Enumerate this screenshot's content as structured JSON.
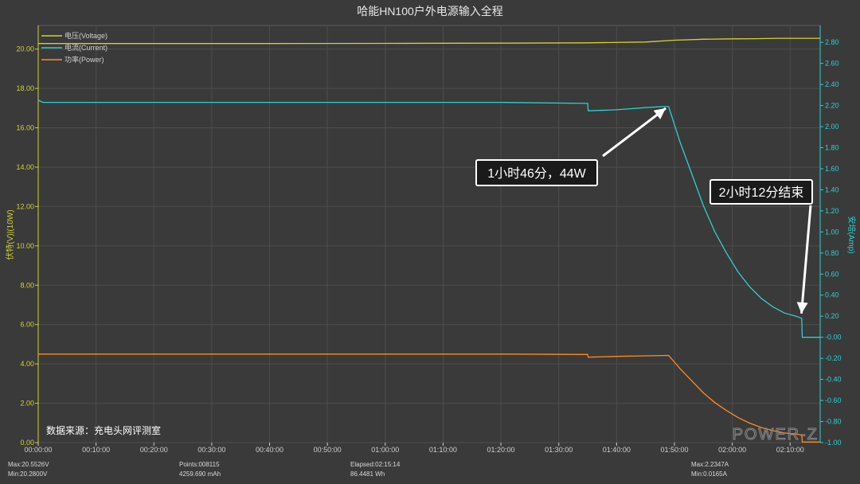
{
  "chart_data": {
    "type": "line",
    "title": "哈能HN100户外电源输入全程",
    "ylabel_left": "伏特(V)|(10W)",
    "ylabel_right": "安培(Amp)",
    "left_axis": {
      "min": 0,
      "max": 21.2,
      "ticks": [
        "0.00",
        "2.00",
        "4.00",
        "6.00",
        "8.00",
        "10.00",
        "12.00",
        "14.00",
        "16.00",
        "18.00",
        "20.00"
      ]
    },
    "right_axis": {
      "min": -1.0,
      "max": 2.96,
      "ticks": [
        "-1.00",
        "-0.80",
        "-0.60",
        "-0.40",
        "-0.20",
        "-0.00",
        "0.20",
        "0.40",
        "0.60",
        "0.80",
        "1.00",
        "1.20",
        "1.40",
        "1.60",
        "1.80",
        "2.00",
        "2.20",
        "2.40",
        "2.60",
        "2.80"
      ]
    },
    "x_axis": {
      "min_minutes": 0,
      "max_minutes": 135.2,
      "ticks": [
        "00:00:00",
        "00:10:00",
        "00:20:00",
        "00:30:00",
        "00:40:00",
        "00:50:00",
        "01:00:00",
        "01:10:00",
        "01:20:00",
        "01:30:00",
        "01:40:00",
        "01:50:00",
        "02:00:00",
        "02:10:00"
      ]
    },
    "series": [
      {
        "name": "电压(Voltage)",
        "axis": "left",
        "color": "#d2d233",
        "points": [
          [
            0,
            20.28
          ],
          [
            20,
            20.28
          ],
          [
            40,
            20.28
          ],
          [
            60,
            20.29
          ],
          [
            80,
            20.3
          ],
          [
            95,
            20.32
          ],
          [
            105,
            20.36
          ],
          [
            110,
            20.45
          ],
          [
            115,
            20.5
          ],
          [
            120,
            20.52
          ],
          [
            124,
            20.53
          ],
          [
            128,
            20.55
          ],
          [
            135.2,
            20.55
          ]
        ]
      },
      {
        "name": "电流(Current)",
        "axis": "right",
        "color": "#2ed0d0",
        "points": [
          [
            0,
            2.25
          ],
          [
            0.8,
            2.23
          ],
          [
            20,
            2.23
          ],
          [
            40,
            2.23
          ],
          [
            60,
            2.23
          ],
          [
            80,
            2.23
          ],
          [
            95,
            2.22
          ],
          [
            95.1,
            2.15
          ],
          [
            100,
            2.16
          ],
          [
            105,
            2.18
          ],
          [
            108,
            2.19
          ],
          [
            109,
            2.19
          ],
          [
            111,
            1.85
          ],
          [
            113,
            1.55
          ],
          [
            115,
            1.25
          ],
          [
            117,
            1.0
          ],
          [
            119,
            0.8
          ],
          [
            121,
            0.62
          ],
          [
            123,
            0.48
          ],
          [
            125,
            0.37
          ],
          [
            127,
            0.29
          ],
          [
            129,
            0.23
          ],
          [
            131,
            0.2
          ],
          [
            132,
            0.18
          ],
          [
            132.1,
            0.0
          ],
          [
            135.2,
            0.0
          ]
        ]
      },
      {
        "name": "功率(Power)",
        "axis": "left",
        "color": "#ff8c1a",
        "points": [
          [
            0,
            4.5
          ],
          [
            20,
            4.5
          ],
          [
            40,
            4.5
          ],
          [
            60,
            4.5
          ],
          [
            80,
            4.5
          ],
          [
            95,
            4.48
          ],
          [
            95.1,
            4.34
          ],
          [
            100,
            4.38
          ],
          [
            105,
            4.41
          ],
          [
            109,
            4.43
          ],
          [
            111,
            3.75
          ],
          [
            113,
            3.14
          ],
          [
            115,
            2.53
          ],
          [
            117,
            2.03
          ],
          [
            119,
            1.63
          ],
          [
            121,
            1.27
          ],
          [
            123,
            0.99
          ],
          [
            125,
            0.77
          ],
          [
            127,
            0.61
          ],
          [
            129,
            0.49
          ],
          [
            131,
            0.43
          ],
          [
            132,
            0.39
          ],
          [
            132.1,
            0.03
          ],
          [
            135.2,
            0.03
          ]
        ]
      }
    ],
    "annotations": [
      {
        "text": "1小时46分，44W",
        "at_minutes": 108.5,
        "at_value_right": 2.19
      },
      {
        "text": "2小时12分结束",
        "at_minutes": 132.1,
        "at_value_right": 0.18
      }
    ],
    "source_note": "数据来源：充电头网评测室",
    "watermark": "POWER-Z",
    "legend_position": "top-left",
    "grid": true
  },
  "stats": {
    "max_v": "Max:20.5526V",
    "min_v": "Min:20.2800V",
    "points": "Points:008115",
    "mah": "4259.690 mAh",
    "elapsed": "Elapsed:02:15:14",
    "wh": "86.4481 Wh",
    "max_a": "Max:2.2347A",
    "min_a": "Min:0.0165A"
  },
  "colors": {
    "background": "#3a3a3a",
    "grid": "#4d4d4d",
    "left_axis": "#d2d233",
    "right_axis": "#2ed0d0",
    "annotation_box": "#ffffff"
  }
}
